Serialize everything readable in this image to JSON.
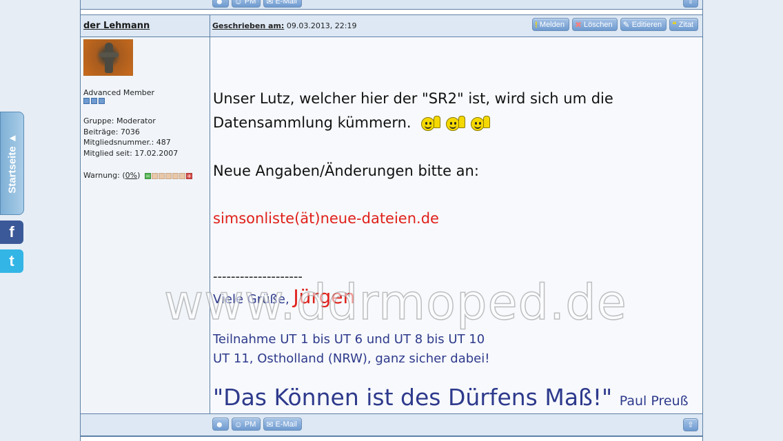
{
  "post": {
    "author": "der Lehmann",
    "written_label": "Geschrieben am:",
    "written_date": "09.03.2013, 22:19",
    "actions": [
      {
        "label": "Melden",
        "icon": "!"
      },
      {
        "label": "Löschen",
        "icon": "✖"
      },
      {
        "label": "Editieren",
        "icon": "✎"
      },
      {
        "label": "Zitat",
        "icon": "❝"
      }
    ]
  },
  "profile": {
    "rank": "Advanced Member",
    "group": "Gruppe: Moderator",
    "posts": "Beiträge: 7036",
    "member_no": "Mitgliedsnummer.: 487",
    "member_since": "Mitglied seit: 17.02.2007",
    "warning_label": "Warnung: (",
    "warning_value": "0%",
    "warning_close": ")"
  },
  "message": {
    "line1": "Unser Lutz, welcher hier der \"SR2\" ist, wird sich um die",
    "line2": "Datensammlung kümmern.",
    "line3": "Neue Angaben/Änderungen bitte an:",
    "email": "simsonliste(ät)neue-dateien.de",
    "separator": "--------------------",
    "greeting": "Viele Grüße,",
    "greeting_name": "Jürgen",
    "sig1": "Teilnahme UT 1 bis UT 6 und UT 8 bis UT 10",
    "sig2": "UT 11, Ostholland (NRW), ganz sicher dabei!",
    "quote": "\"Das Können ist des Dürfens Maß!\"",
    "quote_author": "Paul Preuß"
  },
  "footer": {
    "pm_label": "PM",
    "email_label": "E-Mail"
  },
  "sidebar": {
    "tab_label": "Startseite ▲",
    "facebook": "f",
    "twitter": "t"
  },
  "watermark": "www.ddrmoped.de",
  "colors": {
    "accent_blue": "#6f9bd0",
    "email_red": "#e0201a",
    "signature_blue": "#2e3a8c"
  }
}
